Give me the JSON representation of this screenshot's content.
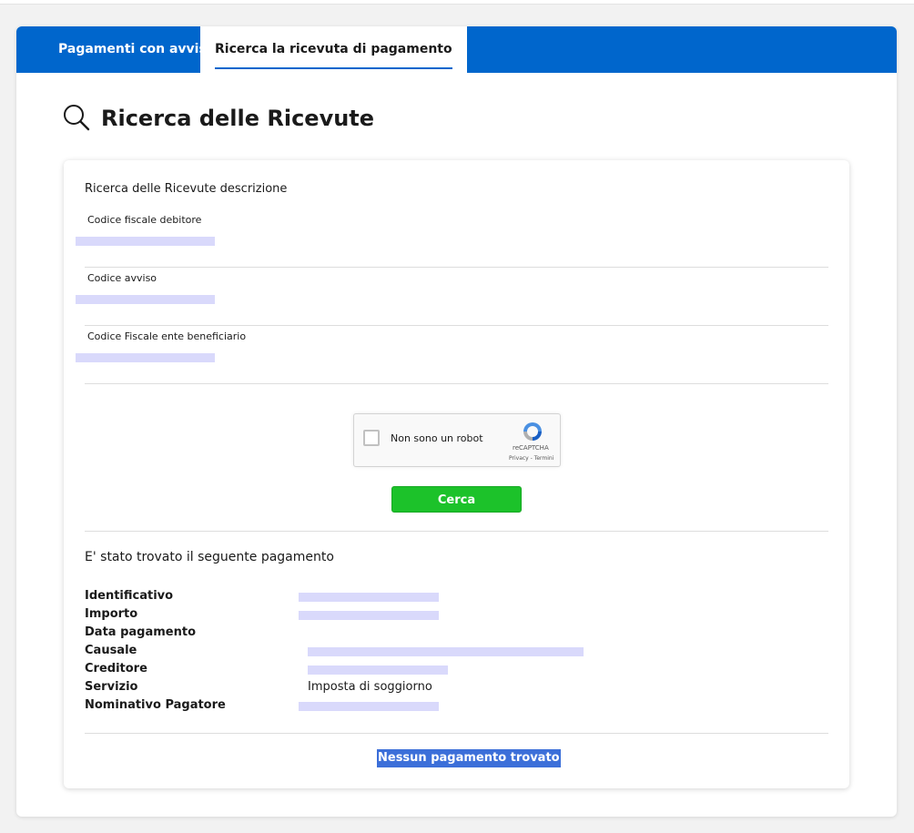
{
  "tabs": [
    {
      "label": "Pagamenti con avviso",
      "active": false
    },
    {
      "label": "Ricerca la ricevuta di pagamento",
      "active": true
    }
  ],
  "page": {
    "title": "Ricerca delle Ricevute",
    "icon": "search-icon"
  },
  "form": {
    "description": "Ricerca delle Ricevute descrizione",
    "fields": [
      {
        "label": "Codice fiscale debitore",
        "value": ""
      },
      {
        "label": "Codice avviso",
        "value": ""
      },
      {
        "label": "Codice Fiscale ente beneficiario",
        "value": ""
      }
    ],
    "captcha": {
      "label": "Non sono un robot",
      "brand": "reCAPTCHA",
      "links": "Privacy - Termini"
    },
    "submit_label": "Cerca"
  },
  "result": {
    "heading": "E' stato trovato il seguente pagamento",
    "rows": [
      {
        "key": "Identificativo",
        "value": ""
      },
      {
        "key": "Importo",
        "value": ""
      },
      {
        "key": "Data pagamento",
        "value": ""
      },
      {
        "key": "Causale",
        "value": ""
      },
      {
        "key": "Creditore",
        "value": ""
      },
      {
        "key": "Servizio",
        "value": "Imposta di soggiorno"
      },
      {
        "key": "Nominativo Pagatore",
        "value": ""
      }
    ],
    "no_result": "Nessun pagamento trovato"
  },
  "colors": {
    "brand_blue": "#0066cc",
    "button_green": "#1cc22a",
    "highlight": "#3c6fd9"
  }
}
